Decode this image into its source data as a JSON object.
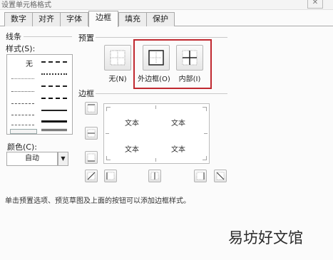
{
  "window": {
    "title": "设置单元格格式",
    "close_glyph": "✕"
  },
  "tabs": [
    {
      "label": "数字"
    },
    {
      "label": "对齐"
    },
    {
      "label": "字体"
    },
    {
      "label": "边框",
      "active": true
    },
    {
      "label": "填充"
    },
    {
      "label": "保护"
    }
  ],
  "line_group": {
    "label": "线条",
    "style_label": "样式(S):",
    "none_label": "无",
    "color_label": "颜色(C):",
    "color_value": "自动"
  },
  "presets": {
    "label": "预置",
    "items": [
      {
        "label": "无(N)",
        "icon": "preset-none-icon"
      },
      {
        "label": "外边框(O)",
        "icon": "preset-outline-icon"
      },
      {
        "label": "内部(I)",
        "icon": "preset-inside-icon"
      }
    ],
    "highlight_color": "#c0282f"
  },
  "border": {
    "label": "边框",
    "preview_text": "文本"
  },
  "hint": "单击预置选项、预览草图及上面的按钮可以添加边框样式。",
  "watermark": "易坊好文馆"
}
